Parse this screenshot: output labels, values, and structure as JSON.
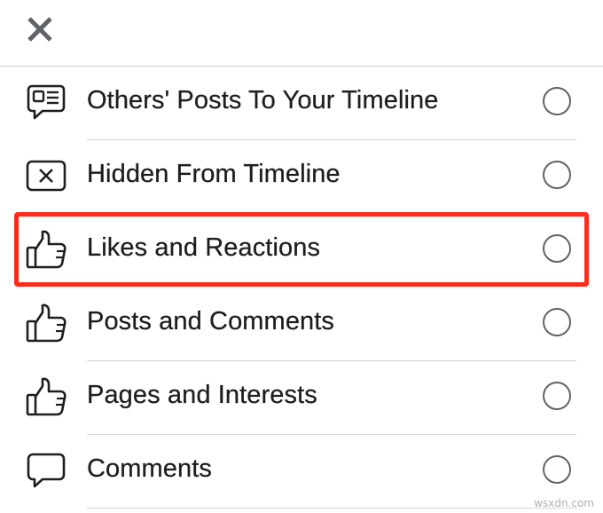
{
  "header": {
    "close_icon": "close-icon"
  },
  "options": [
    {
      "label": "Others' Posts To Your Timeline",
      "icon": "message-box-icon",
      "selected": false
    },
    {
      "label": "Hidden From Timeline",
      "icon": "hidden-x-box-icon",
      "selected": false
    },
    {
      "label": "Likes and Reactions",
      "icon": "thumbs-up-icon",
      "selected": false,
      "highlighted": true
    },
    {
      "label": "Posts and Comments",
      "icon": "thumbs-up-icon",
      "selected": false
    },
    {
      "label": "Pages and Interests",
      "icon": "thumbs-up-icon",
      "selected": false
    },
    {
      "label": "Comments",
      "icon": "speech-bubble-icon",
      "selected": false
    }
  ],
  "colors": {
    "highlight_border": "#ff2a1a",
    "radio_border": "#5f6368",
    "text": "#1c1e21"
  },
  "watermark": "wsxdn.com"
}
